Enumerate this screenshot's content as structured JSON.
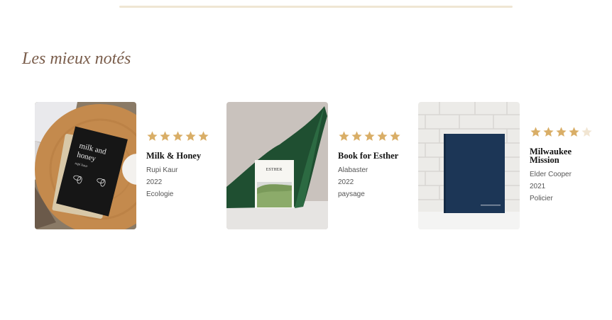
{
  "section": {
    "title": "Les mieux notés"
  },
  "colors": {
    "star_filled": "#d9ae67",
    "star_empty": "#f1e5d2",
    "title": "#7a5d4b"
  },
  "books": [
    {
      "title": "Milk & Honey",
      "author": "Rupi Kaur",
      "year": "2022",
      "genre": "Ecologie",
      "rating": 5,
      "cover": {
        "line1": "milk and",
        "line2": "honey",
        "author": "rupi kaur"
      }
    },
    {
      "title": "Book for Esther",
      "author": "Alabaster",
      "year": "2022",
      "genre": "paysage",
      "rating": 5,
      "cover": {
        "line1": "ESTHER"
      }
    },
    {
      "title": "Milwaukee Mission",
      "author": "Elder Cooper",
      "year": "2021",
      "genre": "Policier",
      "rating": 4
    }
  ]
}
